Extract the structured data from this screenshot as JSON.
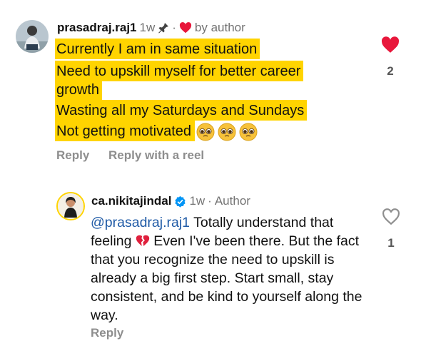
{
  "comment": {
    "username": "prasadraj.raj1",
    "time": "1w",
    "dot": "·",
    "liked_by": "by author",
    "lines": [
      "Currently I am in same situation",
      "Need to upskill myself for better career",
      "growth",
      "Wasting all my Saturdays and Sundays",
      "Not getting motivated"
    ],
    "actions": {
      "reply": "Reply",
      "reply_reel": "Reply with a reel"
    },
    "like_count": "2",
    "icons": {
      "pin": "pin-icon",
      "heart_small": "red-heart-icon",
      "emoji": "pleading-face-emoji",
      "like": "heart-filled-icon"
    },
    "colors": {
      "highlight": "#ffd400",
      "heart": "#e8173b"
    }
  },
  "reply": {
    "username": "ca.nikitajindal",
    "verified": "verified-badge-icon",
    "time": "1w",
    "dot": "·",
    "role": "Author",
    "mention": "@prasadraj.raj1",
    "text_part1": " Totally understand that feeling ",
    "text_part2": " Even I've been there. But the fact that you recognize the need to upskill is already a big first step. Start small, stay consistent, and be kind to yourself along the way.",
    "action_reply": "Reply",
    "like_count": "1",
    "icons": {
      "broken_heart": "broken-heart-emoji",
      "like": "heart-outline-icon"
    },
    "colors": {
      "mention": "#1f5aa6",
      "verified": "#0095f6"
    }
  }
}
